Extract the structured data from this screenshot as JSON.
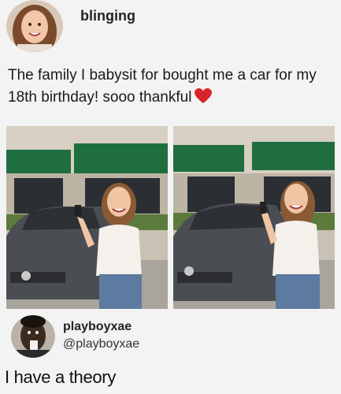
{
  "post": {
    "username": "blinging",
    "caption": "The family I babysit for bought me a car for my 18th birthday! sooo thankful",
    "emoji": "red-heart"
  },
  "photos": [
    {
      "description_icon": "photo-girl-with-car-left"
    },
    {
      "description_icon": "photo-girl-with-car-right"
    }
  ],
  "reply": {
    "name": "playboyxae",
    "handle": "@playboyxae",
    "text": "I have a theory"
  },
  "colors": {
    "awning": "#1f6e3f",
    "car": "#4a4d52",
    "heart": "#d9242b"
  }
}
